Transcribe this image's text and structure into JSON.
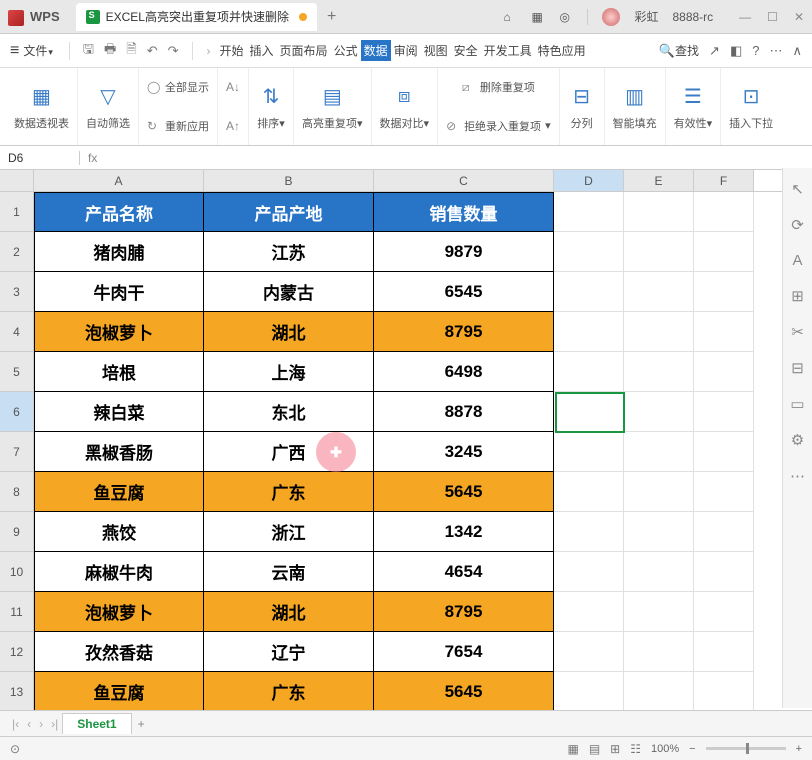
{
  "title": {
    "app": "WPS",
    "filename": "EXCEL高亮突出重复项并快速删除",
    "username": "彩虹",
    "account": "8888-rc"
  },
  "menu": {
    "file": "文件",
    "tabs": [
      "开始",
      "插入",
      "页面布局",
      "公式",
      "数据",
      "审阅",
      "视图",
      "安全",
      "开发工具",
      "特色应用"
    ],
    "active_tab": "数据",
    "search": "查找"
  },
  "toolbar": {
    "pivot": "数据透视表",
    "autofilter": "自动筛选",
    "showall": "全部显示",
    "reapply": "重新应用",
    "sort": "排序",
    "highlight_dup": "高亮重复项",
    "compare": "数据对比",
    "remove_dup": "删除重复项",
    "reject_dup": "拒绝录入重复项",
    "split_col": "分列",
    "smart_fill": "智能填充",
    "validity": "有效性",
    "insert_dd": "插入下拉"
  },
  "cellref": "D6",
  "cols": [
    "A",
    "B",
    "C",
    "D",
    "E",
    "F"
  ],
  "selected_col": "D",
  "selected_row": "6",
  "sheet": {
    "headers": [
      "产品名称",
      "产品产地",
      "销售数量"
    ],
    "rows": [
      {
        "n": "2",
        "a": "猪肉脯",
        "b": "江苏",
        "c": "9879",
        "hl": false
      },
      {
        "n": "3",
        "a": "牛肉干",
        "b": "内蒙古",
        "c": "6545",
        "hl": false
      },
      {
        "n": "4",
        "a": "泡椒萝卜",
        "b": "湖北",
        "c": "8795",
        "hl": true
      },
      {
        "n": "5",
        "a": "培根",
        "b": "上海",
        "c": "6498",
        "hl": false
      },
      {
        "n": "6",
        "a": "辣白菜",
        "b": "东北",
        "c": "8878",
        "hl": false
      },
      {
        "n": "7",
        "a": "黑椒香肠",
        "b": "广西",
        "c": "3245",
        "hl": false
      },
      {
        "n": "8",
        "a": "鱼豆腐",
        "b": "广东",
        "c": "5645",
        "hl": true
      },
      {
        "n": "9",
        "a": "燕饺",
        "b": "浙江",
        "c": "1342",
        "hl": false
      },
      {
        "n": "10",
        "a": "麻椒牛肉",
        "b": "云南",
        "c": "4654",
        "hl": false
      },
      {
        "n": "11",
        "a": "泡椒萝卜",
        "b": "湖北",
        "c": "8795",
        "hl": true
      },
      {
        "n": "12",
        "a": "孜然香菇",
        "b": "辽宁",
        "c": "7654",
        "hl": false
      },
      {
        "n": "13",
        "a": "鱼豆腐",
        "b": "广东",
        "c": "5645",
        "hl": true
      }
    ]
  },
  "sheettab": "Sheet1",
  "zoom": "100%",
  "chart_data": {
    "type": "table",
    "title": "",
    "columns": [
      "产品名称",
      "产品产地",
      "销售数量"
    ],
    "rows": [
      [
        "猪肉脯",
        "江苏",
        9879
      ],
      [
        "牛肉干",
        "内蒙古",
        6545
      ],
      [
        "泡椒萝卜",
        "湖北",
        8795
      ],
      [
        "培根",
        "上海",
        6498
      ],
      [
        "辣白菜",
        "东北",
        8878
      ],
      [
        "黑椒香肠",
        "广西",
        3245
      ],
      [
        "鱼豆腐",
        "广东",
        5645
      ],
      [
        "燕饺",
        "浙江",
        1342
      ],
      [
        "麻椒牛肉",
        "云南",
        4654
      ],
      [
        "泡椒萝卜",
        "湖北",
        8795
      ],
      [
        "孜然香菇",
        "辽宁",
        7654
      ],
      [
        "鱼豆腐",
        "广东",
        5645
      ]
    ]
  }
}
